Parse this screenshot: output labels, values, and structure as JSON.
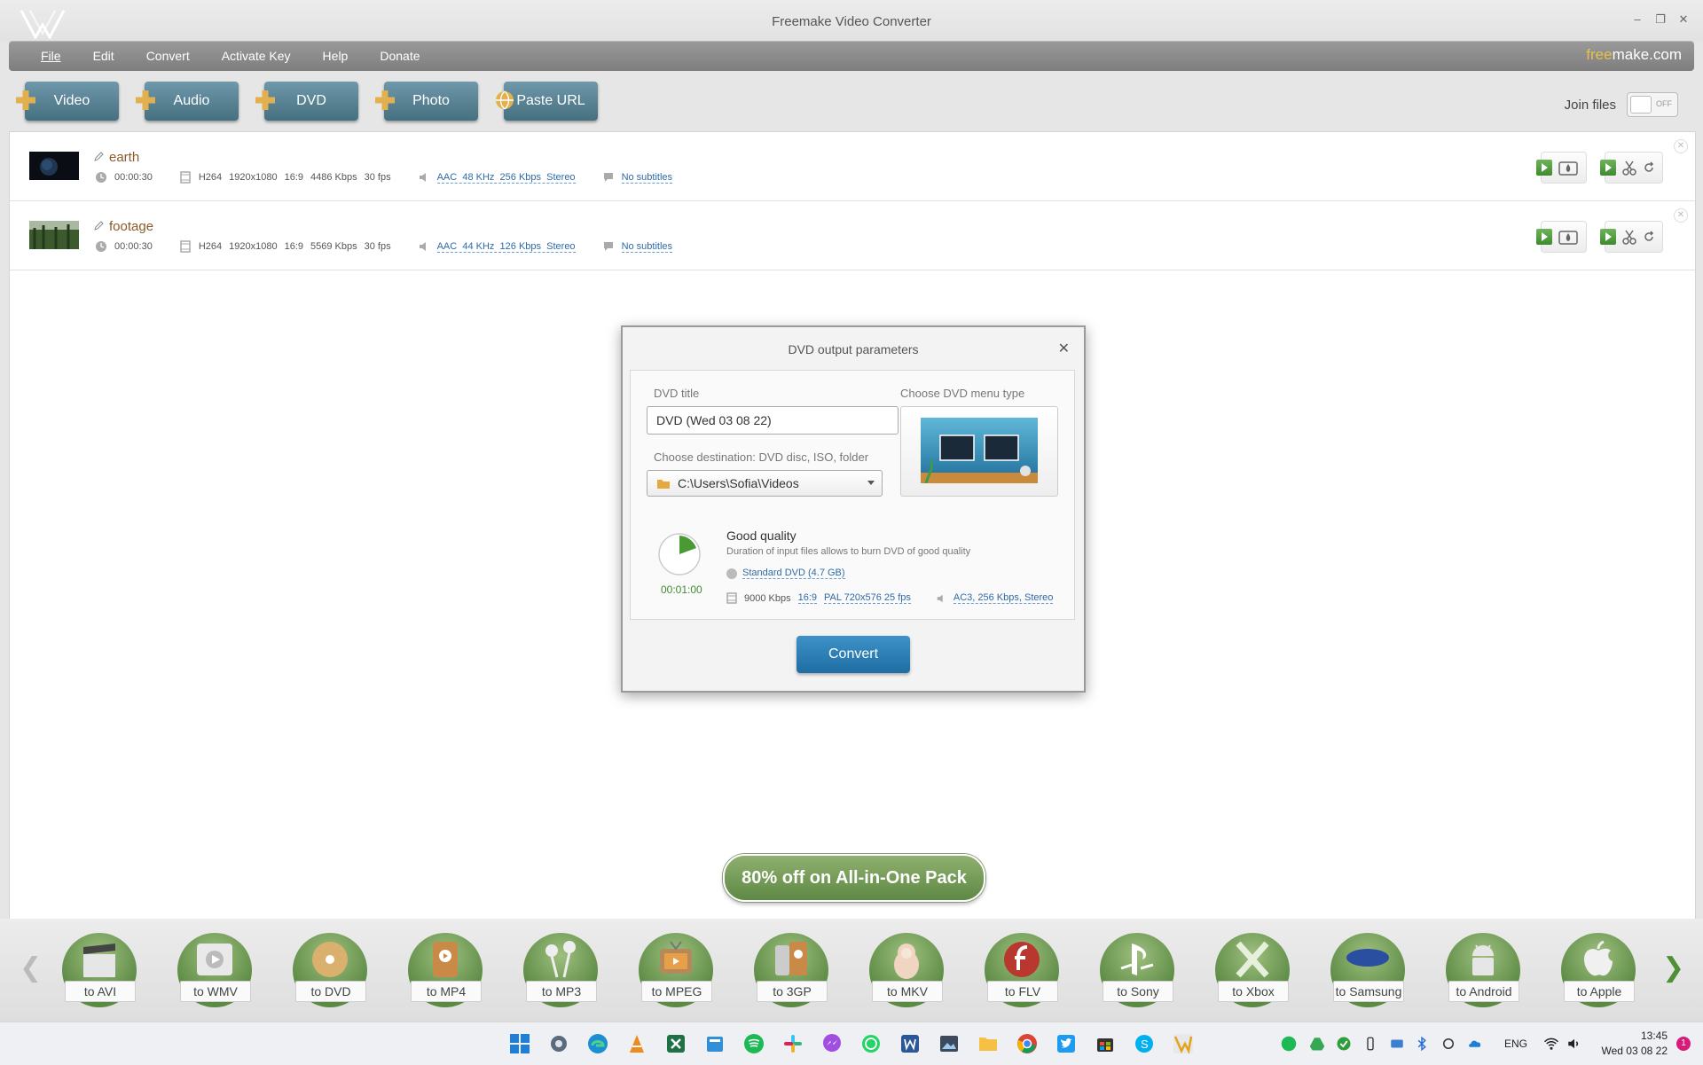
{
  "window": {
    "title": "Freemake Video Converter"
  },
  "menu": {
    "items": [
      "File",
      "Edit",
      "Convert",
      "Activate Key",
      "Help",
      "Donate"
    ],
    "brand_a": "free",
    "brand_b": "make.com"
  },
  "toolbar": {
    "buttons": [
      "Video",
      "Audio",
      "DVD",
      "Photo",
      "Paste URL"
    ],
    "join_label": "Join files",
    "join_state": "OFF"
  },
  "files": [
    {
      "name": "earth",
      "duration": "00:00:30",
      "codec": "H264",
      "resolution": "1920x1080",
      "aspect": "16:9",
      "bitrate": "4486 Kbps",
      "fps": "30 fps",
      "audio": [
        "AAC",
        "48 KHz",
        "256 Kbps",
        "Stereo"
      ],
      "subtitles": "No subtitles"
    },
    {
      "name": "footage",
      "duration": "00:00:30",
      "codec": "H264",
      "resolution": "1920x1080",
      "aspect": "16:9",
      "bitrate": "5569 Kbps",
      "fps": "30 fps",
      "audio": [
        "AAC",
        "44 KHz",
        "126 Kbps",
        "Stereo"
      ],
      "subtitles": "No subtitles"
    }
  ],
  "dialog": {
    "title": "DVD output parameters",
    "dvd_title_label": "DVD title",
    "dvd_title_value": "DVD (Wed 03 08 22)",
    "menu_type_label": "Choose DVD menu type",
    "destination_label": "Choose destination: DVD disc, ISO, folder",
    "destination_value": "C:\\Users\\Sofia\\Videos",
    "quality_title": "Good quality",
    "quality_desc": "Duration of input files allows to burn DVD of good quality",
    "duration": "00:01:00",
    "disc": "Standard DVD (4.7 GB)",
    "video_bitrate": "9000 Kbps",
    "aspect": "16:9",
    "video_format": "PAL 720x576 25 fps",
    "audio": "AC3, 256 Kbps, Stereo",
    "convert_label": "Convert"
  },
  "promo": {
    "label": "80% off on All-in-One Pack"
  },
  "conversions": [
    "to AVI",
    "to WMV",
    "to DVD",
    "to MP4",
    "to MP3",
    "to MPEG",
    "to 3GP",
    "to MKV",
    "to FLV",
    "to Sony",
    "to Xbox",
    "to Samsung",
    "to Android",
    "to Apple"
  ],
  "taskbar": {
    "lang": "ENG",
    "time": "13:45",
    "date": "Wed 03 08 22",
    "notifications": "1"
  },
  "colors": {
    "menubar": "#8a8a8a",
    "add_button": "#5a8495",
    "convert_button": "#2a7fb8",
    "format_green": "#6a9a50",
    "promo_green": "#76a05a"
  }
}
